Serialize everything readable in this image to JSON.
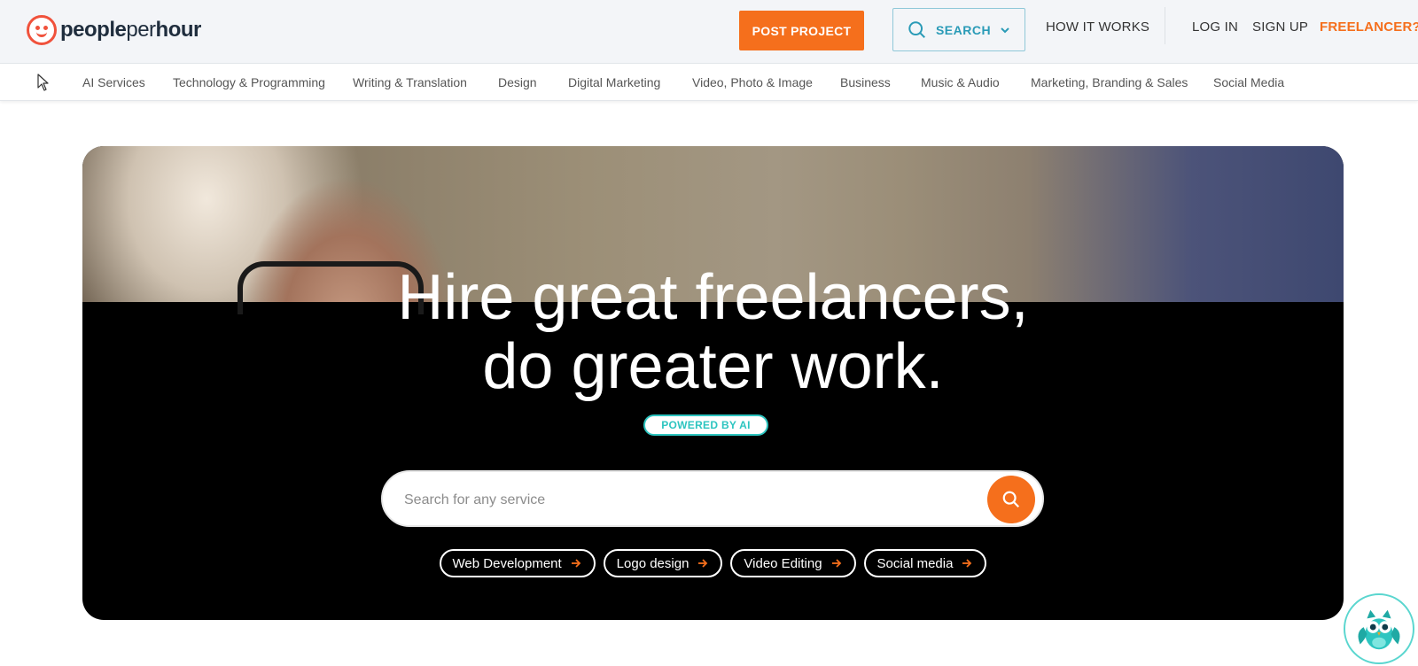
{
  "brand": {
    "name_part1": "people",
    "name_part2": "per",
    "name_part3": "hour",
    "logo_icon": "smiley-face-icon",
    "accent_color": "#f56f1c",
    "logo_color": "#f0523c"
  },
  "header": {
    "post_project_label": "POST PROJECT",
    "search_label": "SEARCH",
    "how_it_works_label": "HOW IT WORKS",
    "login_label": "LOG IN",
    "signup_label": "SIGN UP",
    "freelancer_label": "FREELANCER?"
  },
  "categories": [
    "AI Services",
    "Technology & Programming",
    "Writing & Translation",
    "Design",
    "Digital Marketing",
    "Video, Photo & Image",
    "Business",
    "Music & Audio",
    "Marketing, Branding & Sales",
    "Social Media"
  ],
  "hero": {
    "title_line1": "Hire great freelancers,",
    "title_line2": "do greater work.",
    "badge": "POWERED BY AI",
    "search_placeholder": "Search for any service",
    "chips": [
      "Web Development",
      "Logo design",
      "Video Editing",
      "Social media"
    ]
  },
  "chatbot": {
    "icon": "owl-bot-icon",
    "color": "#2dc5c0"
  }
}
